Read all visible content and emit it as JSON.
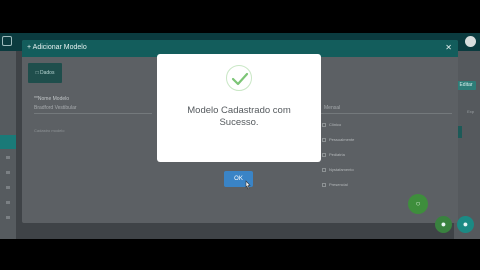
{
  "modal": {
    "title": "+ Adicionar Modelo",
    "close_icon": "close-icon",
    "tab_label": "Dados",
    "field_label": "**Nome Modelo",
    "field_value": "Bradford Vestibular",
    "secondary_label": "Cadastro modelo",
    "right_value": "Mensal",
    "options": [
      "Clínico",
      "Pessoalmente",
      "Pediatria",
      "Nystafamento",
      "Presencial"
    ]
  },
  "app": {
    "right_button": "Editar",
    "right_label": "Exp"
  },
  "alert": {
    "icon": "checkmark-success-icon",
    "title_line1": "Modelo Cadastrado com",
    "title_line2": "Sucesso.",
    "ok_label": "OK"
  },
  "colors": {
    "header": "#135d5c",
    "ok_button": "#3a84c6",
    "success": "#7cc576"
  }
}
